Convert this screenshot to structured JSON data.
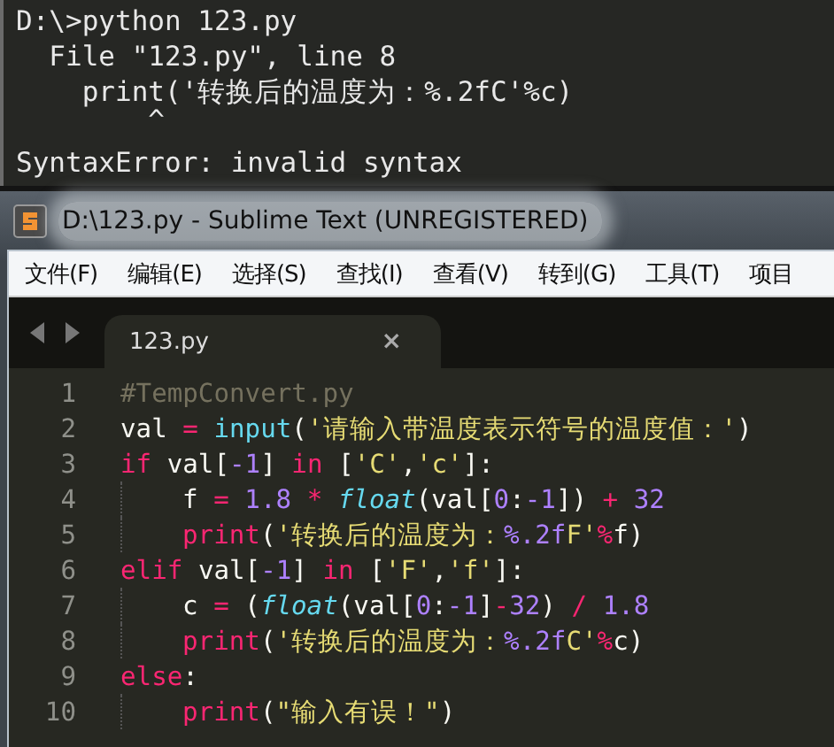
{
  "terminal": {
    "lines": [
      {
        "kind": "text",
        "text": "D:\\>python 123.py"
      },
      {
        "kind": "text",
        "text": "  File \"123.py\", line 8"
      },
      {
        "kind": "text",
        "text": "    print('转换后的温度为：%.2fC'%c)"
      },
      {
        "kind": "caret",
        "text": "        ^"
      },
      {
        "kind": "error",
        "text": "SyntaxError: invalid syntax"
      }
    ]
  },
  "window": {
    "title": "D:\\123.py - Sublime Text (UNREGISTERED)"
  },
  "menu": [
    "文件(F)",
    "编辑(E)",
    "选择(S)",
    "查找(I)",
    "查看(V)",
    "转到(G)",
    "工具(T)",
    "项目"
  ],
  "tabs": [
    {
      "label": "123.py",
      "selected": true,
      "close": "×"
    }
  ],
  "editor": {
    "lines": [
      {
        "number": "1",
        "indent": false,
        "tokens": [
          {
            "kind": "comment",
            "text": "#TempConvert.py"
          }
        ]
      },
      {
        "number": "2",
        "indent": false,
        "tokens": [
          {
            "kind": "plain",
            "text": "val "
          },
          {
            "kind": "keyword",
            "text": "= "
          },
          {
            "kind": "builtin",
            "text": "input"
          },
          {
            "kind": "plain",
            "text": "("
          },
          {
            "kind": "string",
            "text": "'请输入带温度表示符号的温度值：'"
          },
          {
            "kind": "plain",
            "text": ")"
          }
        ]
      },
      {
        "number": "3",
        "indent": false,
        "tokens": [
          {
            "kind": "keyword",
            "text": "if"
          },
          {
            "kind": "plain",
            "text": " val["
          },
          {
            "kind": "number",
            "text": "-1"
          },
          {
            "kind": "plain",
            "text": "] "
          },
          {
            "kind": "keyword",
            "text": "in"
          },
          {
            "kind": "plain",
            "text": " ["
          },
          {
            "kind": "string",
            "text": "'C'"
          },
          {
            "kind": "plain",
            "text": ","
          },
          {
            "kind": "string",
            "text": "'c'"
          },
          {
            "kind": "plain",
            "text": "]:"
          }
        ]
      },
      {
        "number": "4",
        "indent": true,
        "tokens": [
          {
            "kind": "plain",
            "text": "f "
          },
          {
            "kind": "keyword",
            "text": "= "
          },
          {
            "kind": "number",
            "text": "1.8 "
          },
          {
            "kind": "keyword",
            "text": "* "
          },
          {
            "kind": "italic",
            "text": "float"
          },
          {
            "kind": "plain",
            "text": "(val["
          },
          {
            "kind": "number",
            "text": "0"
          },
          {
            "kind": "plain",
            "text": ":"
          },
          {
            "kind": "number",
            "text": "-1"
          },
          {
            "kind": "plain",
            "text": "]) "
          },
          {
            "kind": "keyword",
            "text": "+ "
          },
          {
            "kind": "number",
            "text": "32"
          }
        ]
      },
      {
        "number": "5",
        "indent": true,
        "tokens": [
          {
            "kind": "keyword",
            "text": "print"
          },
          {
            "kind": "plain",
            "text": "("
          },
          {
            "kind": "string",
            "text": "'转换后的温度为："
          },
          {
            "kind": "number",
            "text": "%.2f"
          },
          {
            "kind": "string",
            "text": "F'"
          },
          {
            "kind": "keyword",
            "text": "%"
          },
          {
            "kind": "plain",
            "text": "f)"
          }
        ]
      },
      {
        "number": "6",
        "indent": false,
        "tokens": [
          {
            "kind": "keyword",
            "text": "elif"
          },
          {
            "kind": "plain",
            "text": " val["
          },
          {
            "kind": "number",
            "text": "-1"
          },
          {
            "kind": "plain",
            "text": "] "
          },
          {
            "kind": "keyword",
            "text": "in"
          },
          {
            "kind": "plain",
            "text": " ["
          },
          {
            "kind": "string",
            "text": "'F'"
          },
          {
            "kind": "plain",
            "text": ","
          },
          {
            "kind": "string",
            "text": "'f'"
          },
          {
            "kind": "plain",
            "text": "]:"
          }
        ]
      },
      {
        "number": "7",
        "indent": true,
        "tokens": [
          {
            "kind": "plain",
            "text": "c "
          },
          {
            "kind": "keyword",
            "text": "="
          },
          {
            "kind": "plain",
            "text": " ("
          },
          {
            "kind": "italic",
            "text": "float"
          },
          {
            "kind": "plain",
            "text": "(val["
          },
          {
            "kind": "number",
            "text": "0"
          },
          {
            "kind": "plain",
            "text": ":"
          },
          {
            "kind": "number",
            "text": "-1"
          },
          {
            "kind": "plain",
            "text": "]"
          },
          {
            "kind": "keyword",
            "text": "-"
          },
          {
            "kind": "number",
            "text": "32"
          },
          {
            "kind": "plain",
            "text": ") "
          },
          {
            "kind": "keyword",
            "text": "/ "
          },
          {
            "kind": "number",
            "text": "1.8"
          }
        ]
      },
      {
        "number": "8",
        "indent": true,
        "tokens": [
          {
            "kind": "keyword",
            "text": "print"
          },
          {
            "kind": "plain",
            "text": "("
          },
          {
            "kind": "string",
            "text": "'转换后的温度为："
          },
          {
            "kind": "number",
            "text": "%.2f"
          },
          {
            "kind": "string",
            "text": "C'"
          },
          {
            "kind": "keyword",
            "text": "%"
          },
          {
            "kind": "plain",
            "text": "c)"
          }
        ]
      },
      {
        "number": "9",
        "indent": false,
        "tokens": [
          {
            "kind": "keyword",
            "text": "else"
          },
          {
            "kind": "plain",
            "text": ":"
          }
        ]
      },
      {
        "number": "10",
        "indent": true,
        "tokens": [
          {
            "kind": "keyword",
            "text": "print"
          },
          {
            "kind": "plain",
            "text": "("
          },
          {
            "kind": "string",
            "text": "\"输入有误！\""
          },
          {
            "kind": "plain",
            "text": ")"
          }
        ]
      }
    ]
  }
}
